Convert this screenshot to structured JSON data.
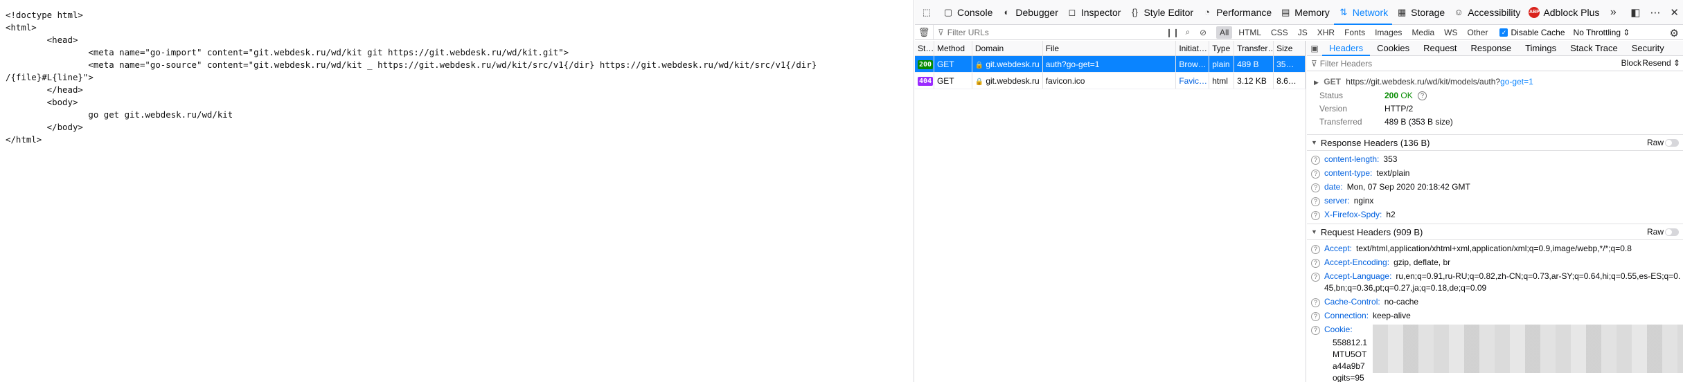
{
  "source_lines": [
    "<!doctype html>",
    "<html>",
    "        <head>",
    "                <meta name=\"go-import\" content=\"git.webdesk.ru/wd/kit git https://git.webdesk.ru/wd/kit.git\">",
    "                <meta name=\"go-source\" content=\"git.webdesk.ru/wd/kit _ https://git.webdesk.ru/wd/kit/src/v1{/dir} https://git.webdesk.ru/wd/kit/src/v1{/dir}",
    "/{file}#L{line}\">",
    "        </head>",
    "        <body>",
    "                go get git.webdesk.ru/wd/kit",
    "        </body>",
    "</html>"
  ],
  "toolbar": {
    "tabs": [
      {
        "label": "Console",
        "icon": "console-icon",
        "glyph": "▢"
      },
      {
        "label": "Debugger",
        "icon": "debugger-icon",
        "glyph": "◐"
      },
      {
        "label": "Inspector",
        "icon": "inspector-icon",
        "glyph": "◻"
      },
      {
        "label": "Style Editor",
        "icon": "style-editor-icon",
        "glyph": "{}"
      },
      {
        "label": "Performance",
        "icon": "performance-icon",
        "glyph": "◔"
      },
      {
        "label": "Memory",
        "icon": "memory-icon",
        "glyph": "▤"
      },
      {
        "label": "Network",
        "icon": "network-icon",
        "glyph": "⇅"
      },
      {
        "label": "Storage",
        "icon": "storage-icon",
        "glyph": "▦"
      },
      {
        "label": "Accessibility",
        "icon": "accessibility-icon",
        "glyph": "☺"
      },
      {
        "label": "Adblock Plus",
        "icon": "adblock-plus-icon",
        "glyph": "ABP"
      }
    ],
    "active_tab": "Network"
  },
  "filterbar": {
    "filter_placeholder": "Filter URLs",
    "types": [
      "All",
      "HTML",
      "CSS",
      "JS",
      "XHR",
      "Fonts",
      "Images",
      "Media",
      "WS",
      "Other"
    ],
    "active_type": "All",
    "disable_cache_label": "Disable Cache",
    "throttling_label": "No Throttling ⇕"
  },
  "request_table": {
    "columns": [
      "St…",
      "Method",
      "Domain",
      "File",
      "Initiat…",
      "Type",
      "Transfer…",
      "Size"
    ],
    "rows": [
      {
        "status": "200",
        "method": "GET",
        "domain": "git.webdesk.ru",
        "file": "auth?go-get=1",
        "initiator": "Brow…",
        "type": "plain",
        "transferred": "489 B",
        "size": "35…"
      },
      {
        "status": "404",
        "method": "GET",
        "domain": "git.webdesk.ru",
        "file": "favicon.ico",
        "initiator": "Favic…",
        "type": "html",
        "transferred": "3.12 KB",
        "size": "8.6…"
      }
    ]
  },
  "details": {
    "tabs": [
      "Headers",
      "Cookies",
      "Request",
      "Response",
      "Timings",
      "Stack Trace",
      "Security"
    ],
    "active_tab": "Headers",
    "filter_placeholder": "Filter Headers",
    "block_label": "Block",
    "resend_label": "Resend ⇕",
    "summary": {
      "method": "GET",
      "url_base": "https://git.webdesk.ru/wd/kit/models/auth?",
      "url_query": "go-get=1",
      "status_label": "Status",
      "status_code": "200",
      "status_text": "OK",
      "version_label": "Version",
      "version": "HTTP/2",
      "transferred_label": "Transferred",
      "transferred": "489 B (353 B size)"
    },
    "response_headers_title": "Response Headers (136 B)",
    "raw_label": "Raw",
    "response_headers": [
      {
        "name": "content-length:",
        "value": "353"
      },
      {
        "name": "content-type:",
        "value": "text/plain"
      },
      {
        "name": "date:",
        "value": "Mon, 07 Sep 2020 20:18:42 GMT"
      },
      {
        "name": "server:",
        "value": "nginx"
      },
      {
        "name": "X-Firefox-Spdy:",
        "value": "h2"
      }
    ],
    "request_headers_title": "Request Headers (909 B)",
    "request_headers": [
      {
        "name": "Accept:",
        "value": "text/html,application/xhtml+xml,application/xml;q=0.9,image/webp,*/*;q=0.8"
      },
      {
        "name": "Accept-Encoding:",
        "value": "gzip, deflate, br"
      },
      {
        "name": "Accept-Language:",
        "value": "ru,en;q=0.91,ru-RU;q=0.82,zh-CN;q=0.73,ar-SY;q=0.64,hi;q=0.55,es-ES;q=0.45,bn;q=0.36,pt;q=0.27,ja;q=0.18,de;q=0.09"
      },
      {
        "name": "Cache-Control:",
        "value": "no-cache"
      },
      {
        "name": "Connection:",
        "value": "keep-alive"
      }
    ],
    "cookie_name": "Cookie:",
    "cookie_visible_fragments": [
      "558812.1",
      "MTU5OT",
      "a44a9b7",
      "ogits=95"
    ]
  }
}
